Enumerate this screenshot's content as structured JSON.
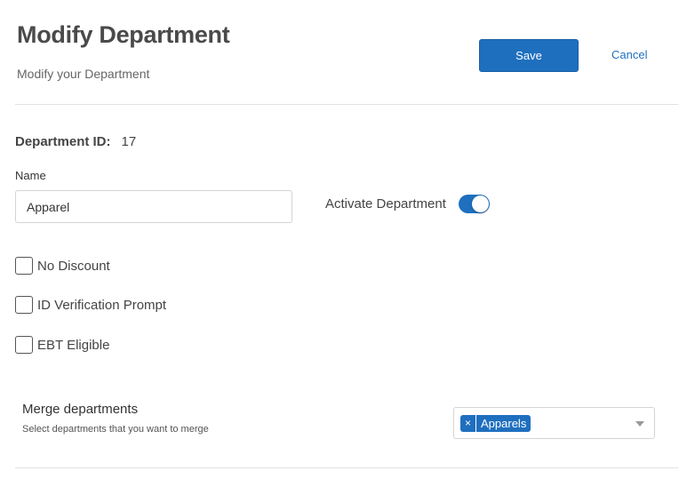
{
  "header": {
    "title": "Modify Department",
    "subtitle": "Modify your Department",
    "save_label": "Save",
    "cancel_label": "Cancel"
  },
  "department": {
    "id_label": "Department ID:",
    "id_value": "17",
    "name_label": "Name",
    "name_value": "Apparel",
    "activate_label": "Activate Department",
    "active": true
  },
  "options": [
    {
      "label": "No Discount",
      "checked": false
    },
    {
      "label": "ID Verification Prompt",
      "checked": false
    },
    {
      "label": "EBT Eligible",
      "checked": false
    }
  ],
  "merge": {
    "title": "Merge departments",
    "description": "Select departments that you want to merge",
    "selected_tags": [
      {
        "remove_symbol": "×",
        "label": "Apparels"
      }
    ],
    "dropdown_icon": "chevron-down-icon"
  },
  "colors": {
    "accent": "#1f6fbf",
    "title_text": "#4a4a4a",
    "divider": "#e2e2e2"
  }
}
